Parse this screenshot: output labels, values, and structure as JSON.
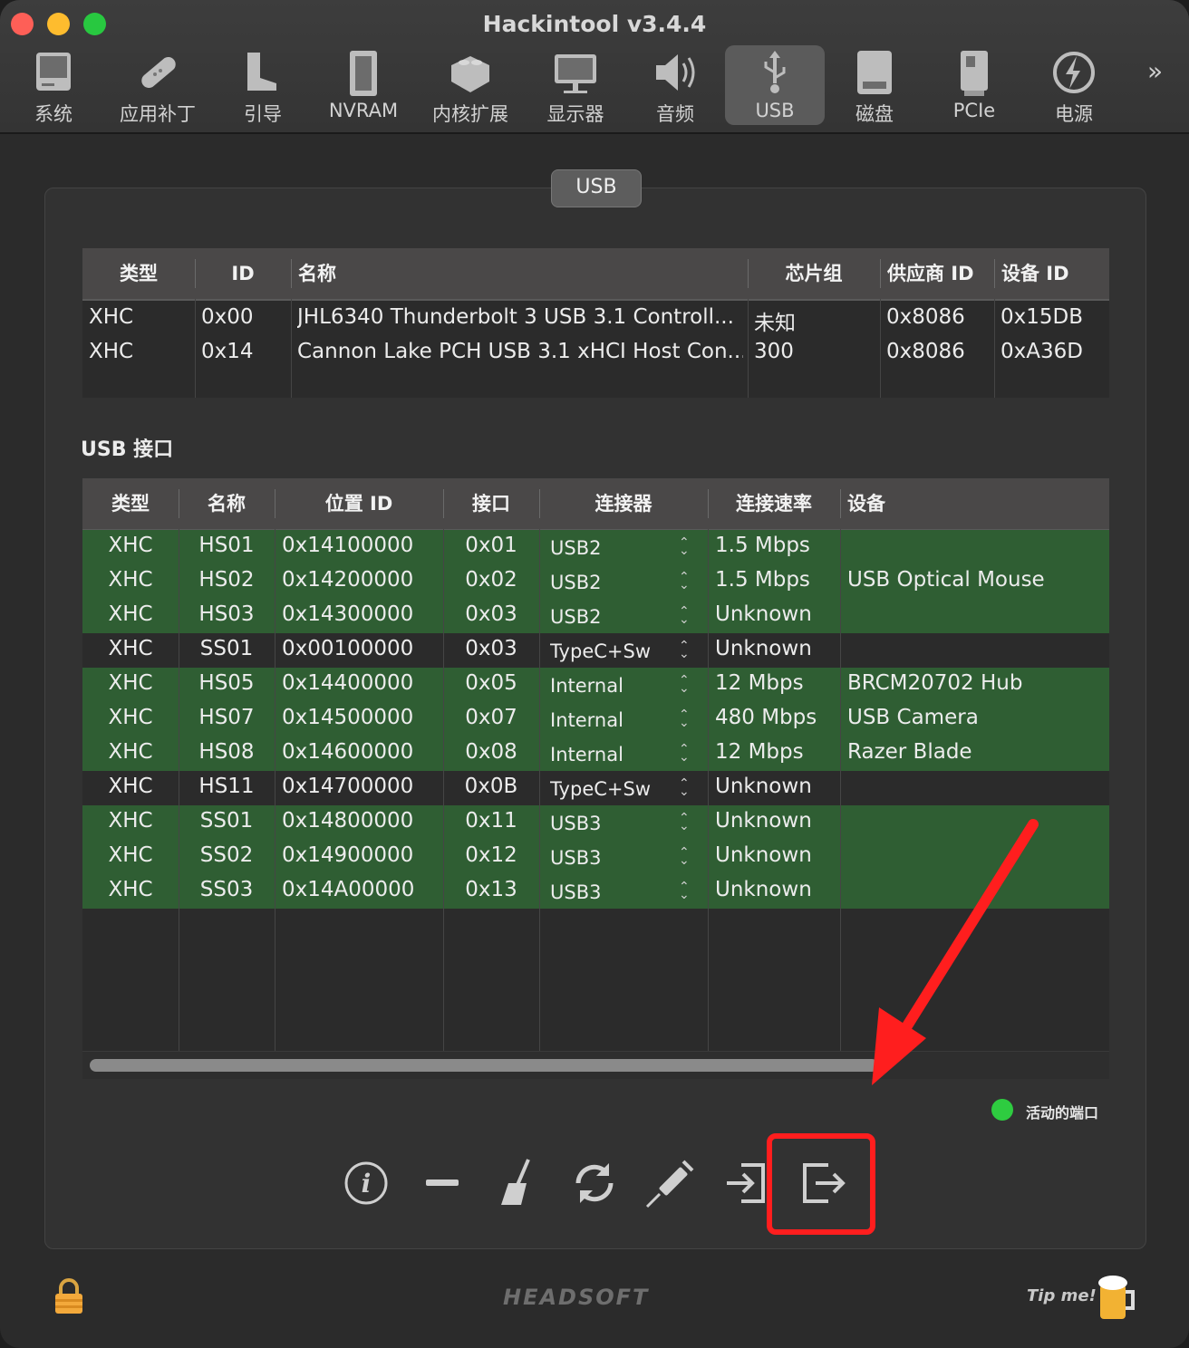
{
  "window": {
    "title": "Hackintool v3.4.4"
  },
  "toolbar": {
    "items": [
      {
        "label": "系统",
        "icon": "computer-icon"
      },
      {
        "label": "应用补丁",
        "icon": "bandage-icon"
      },
      {
        "label": "引导",
        "icon": "boot-icon"
      },
      {
        "label": "NVRAM",
        "icon": "memory-icon"
      },
      {
        "label": "内核扩展",
        "icon": "lego-brick-icon"
      },
      {
        "label": "显示器",
        "icon": "monitor-icon"
      },
      {
        "label": "音频",
        "icon": "speaker-icon"
      },
      {
        "label": "USB",
        "icon": "usb-icon",
        "selected": true
      },
      {
        "label": "磁盘",
        "icon": "disk-icon"
      },
      {
        "label": "PCIe",
        "icon": "pcie-card-icon"
      },
      {
        "label": "电源",
        "icon": "power-bolt-icon"
      }
    ],
    "more": "»"
  },
  "section_tab": "USB",
  "controllers": {
    "headers": [
      "类型",
      "ID",
      "名称",
      "芯片组",
      "供应商 ID",
      "设备 ID"
    ],
    "rows": [
      [
        "XHC",
        "0x00",
        "JHL6340 Thunderbolt 3 USB 3.1 Controll...",
        "未知",
        "0x8086",
        "0x15DB"
      ],
      [
        "XHC",
        "0x14",
        "Cannon Lake PCH USB 3.1 xHCI Host Con...",
        "300",
        "0x8086",
        "0xA36D"
      ]
    ]
  },
  "ports_label": "USB 接口",
  "ports": {
    "headers": [
      "类型",
      "名称",
      "位置 ID",
      "接口",
      "连接器",
      "连接速率",
      "设备"
    ],
    "rows": [
      {
        "type": "XHC",
        "name": "HS01",
        "location": "0x14100000",
        "port": "0x01",
        "connector": "USB2",
        "speed": "1.5 Mbps",
        "device": "",
        "active": true
      },
      {
        "type": "XHC",
        "name": "HS02",
        "location": "0x14200000",
        "port": "0x02",
        "connector": "USB2",
        "speed": "1.5 Mbps",
        "device": "USB Optical Mouse",
        "active": true
      },
      {
        "type": "XHC",
        "name": "HS03",
        "location": "0x14300000",
        "port": "0x03",
        "connector": "USB2",
        "speed": "Unknown",
        "device": "",
        "active": true
      },
      {
        "type": "XHC",
        "name": "SS01",
        "location": "0x00100000",
        "port": "0x03",
        "connector": "TypeC+Sw",
        "speed": "Unknown",
        "device": "",
        "active": false
      },
      {
        "type": "XHC",
        "name": "HS05",
        "location": "0x14400000",
        "port": "0x05",
        "connector": "Internal",
        "speed": "12 Mbps",
        "device": "BRCM20702 Hub",
        "active": true
      },
      {
        "type": "XHC",
        "name": "HS07",
        "location": "0x14500000",
        "port": "0x07",
        "connector": "Internal",
        "speed": "480 Mbps",
        "device": "USB Camera",
        "active": true
      },
      {
        "type": "XHC",
        "name": "HS08",
        "location": "0x14600000",
        "port": "0x08",
        "connector": "Internal",
        "speed": "12 Mbps",
        "device": "Razer Blade",
        "active": true
      },
      {
        "type": "XHC",
        "name": "HS11",
        "location": "0x14700000",
        "port": "0x0B",
        "connector": "TypeC+Sw",
        "speed": "Unknown",
        "device": "",
        "active": false
      },
      {
        "type": "XHC",
        "name": "SS01",
        "location": "0x14800000",
        "port": "0x11",
        "connector": "USB3",
        "speed": "Unknown",
        "device": "",
        "active": true
      },
      {
        "type": "XHC",
        "name": "SS02",
        "location": "0x14900000",
        "port": "0x12",
        "connector": "USB3",
        "speed": "Unknown",
        "device": "",
        "active": true
      },
      {
        "type": "XHC",
        "name": "SS03",
        "location": "0x14A00000",
        "port": "0x13",
        "connector": "USB3",
        "speed": "Unknown",
        "device": "",
        "active": true
      }
    ]
  },
  "legend": {
    "label": "活动的端口",
    "color": "#2ecc40"
  },
  "actions": [
    "info-icon",
    "remove-icon",
    "broom-icon",
    "refresh-icon",
    "syringe-icon",
    "import-icon",
    "export-icon"
  ],
  "footer": {
    "brand": "HEADSOFT",
    "tip": "Tip me!",
    "lock_icon": "lock-icon",
    "beer_icon": "beer-mug-icon"
  },
  "colors": {
    "active_row": "#2f5e33",
    "highlight": "#ff1e1e",
    "arrow": "#ff1e1e"
  }
}
